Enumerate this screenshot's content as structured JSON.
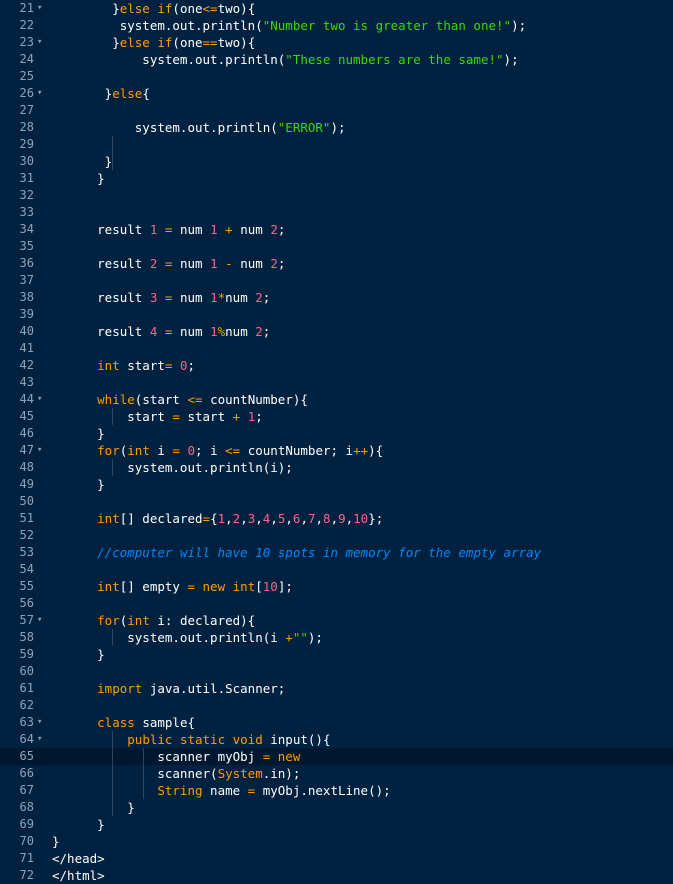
{
  "editor": {
    "colors": {
      "background": "#002240",
      "active_line": "#00182f",
      "keyword": "#ff9d00",
      "string": "#3ad900",
      "number": "#ff628c",
      "comment": "#0088ff",
      "text": "#ffffff",
      "gutter": "#8fa3b8"
    },
    "active_line": 65,
    "lines": [
      {
        "n": "21",
        "fold": true,
        "tokens": [
          [
            "p",
            "        }"
          ],
          [
            "k",
            "else if"
          ],
          [
            "p",
            "(one"
          ],
          [
            "o",
            "<="
          ],
          [
            "p",
            "two){"
          ]
        ]
      },
      {
        "n": "22",
        "fold": false,
        "tokens": [
          [
            "p",
            "         system.out.println("
          ],
          [
            "s",
            "\"Number two is greater than one!\""
          ],
          [
            "p",
            ");"
          ]
        ]
      },
      {
        "n": "23",
        "fold": true,
        "tokens": [
          [
            "p",
            "        }"
          ],
          [
            "k",
            "else if"
          ],
          [
            "p",
            "(one"
          ],
          [
            "o",
            "=="
          ],
          [
            "p",
            "two){"
          ]
        ]
      },
      {
        "n": "24",
        "fold": false,
        "tokens": [
          [
            "p",
            "            system.out.println("
          ],
          [
            "s",
            "\"These numbers are the same!\""
          ],
          [
            "p",
            ");"
          ]
        ]
      },
      {
        "n": "25",
        "fold": false,
        "tokens": []
      },
      {
        "n": "26",
        "fold": true,
        "tokens": [
          [
            "p",
            "       }"
          ],
          [
            "k",
            "else"
          ],
          [
            "p",
            "{"
          ]
        ]
      },
      {
        "n": "27",
        "fold": false,
        "tokens": []
      },
      {
        "n": "28",
        "fold": false,
        "tokens": [
          [
            "p",
            "           system.out.println("
          ],
          [
            "s",
            "\"ERROR\""
          ],
          [
            "p",
            ");"
          ]
        ]
      },
      {
        "n": "29",
        "fold": false,
        "tokens": []
      },
      {
        "n": "30",
        "fold": false,
        "tokens": [
          [
            "p",
            "       }"
          ]
        ]
      },
      {
        "n": "31",
        "fold": false,
        "tokens": [
          [
            "p",
            "      }"
          ]
        ]
      },
      {
        "n": "32",
        "fold": false,
        "tokens": []
      },
      {
        "n": "33",
        "fold": false,
        "tokens": []
      },
      {
        "n": "34",
        "fold": false,
        "tokens": [
          [
            "p",
            "      result "
          ],
          [
            "n",
            "1"
          ],
          [
            "p",
            " "
          ],
          [
            "o",
            "="
          ],
          [
            "p",
            " num "
          ],
          [
            "n",
            "1"
          ],
          [
            "p",
            " "
          ],
          [
            "o",
            "+"
          ],
          [
            "p",
            " num "
          ],
          [
            "n",
            "2"
          ],
          [
            "p",
            ";"
          ]
        ]
      },
      {
        "n": "35",
        "fold": false,
        "tokens": []
      },
      {
        "n": "36",
        "fold": false,
        "tokens": [
          [
            "p",
            "      result "
          ],
          [
            "n",
            "2"
          ],
          [
            "p",
            " "
          ],
          [
            "o",
            "="
          ],
          [
            "p",
            " num "
          ],
          [
            "n",
            "1"
          ],
          [
            "p",
            " "
          ],
          [
            "o",
            "-"
          ],
          [
            "p",
            " num "
          ],
          [
            "n",
            "2"
          ],
          [
            "p",
            ";"
          ]
        ]
      },
      {
        "n": "37",
        "fold": false,
        "tokens": []
      },
      {
        "n": "38",
        "fold": false,
        "tokens": [
          [
            "p",
            "      result "
          ],
          [
            "n",
            "3"
          ],
          [
            "p",
            " "
          ],
          [
            "o",
            "="
          ],
          [
            "p",
            " num "
          ],
          [
            "n",
            "1"
          ],
          [
            "o",
            "*"
          ],
          [
            "p",
            "num "
          ],
          [
            "n",
            "2"
          ],
          [
            "p",
            ";"
          ]
        ]
      },
      {
        "n": "39",
        "fold": false,
        "tokens": []
      },
      {
        "n": "40",
        "fold": false,
        "tokens": [
          [
            "p",
            "      result "
          ],
          [
            "n",
            "4"
          ],
          [
            "p",
            " "
          ],
          [
            "o",
            "="
          ],
          [
            "p",
            " num "
          ],
          [
            "n",
            "1"
          ],
          [
            "o",
            "%"
          ],
          [
            "p",
            "num "
          ],
          [
            "n",
            "2"
          ],
          [
            "p",
            ";"
          ]
        ]
      },
      {
        "n": "41",
        "fold": false,
        "tokens": []
      },
      {
        "n": "42",
        "fold": false,
        "tokens": [
          [
            "p",
            "      "
          ],
          [
            "k",
            "int"
          ],
          [
            "p",
            " start"
          ],
          [
            "o",
            "="
          ],
          [
            "p",
            " "
          ],
          [
            "n",
            "0"
          ],
          [
            "p",
            ";"
          ]
        ]
      },
      {
        "n": "43",
        "fold": false,
        "tokens": []
      },
      {
        "n": "44",
        "fold": true,
        "tokens": [
          [
            "p",
            "      "
          ],
          [
            "k",
            "while"
          ],
          [
            "p",
            "(start "
          ],
          [
            "o",
            "<="
          ],
          [
            "p",
            " countNumber){"
          ]
        ]
      },
      {
        "n": "45",
        "fold": false,
        "tokens": [
          [
            "p",
            "          start "
          ],
          [
            "o",
            "="
          ],
          [
            "p",
            " start "
          ],
          [
            "o",
            "+"
          ],
          [
            "p",
            " "
          ],
          [
            "n",
            "1"
          ],
          [
            "p",
            ";"
          ]
        ]
      },
      {
        "n": "46",
        "fold": false,
        "tokens": [
          [
            "p",
            "      }"
          ]
        ]
      },
      {
        "n": "47",
        "fold": true,
        "tokens": [
          [
            "p",
            "      "
          ],
          [
            "k",
            "for"
          ],
          [
            "p",
            "("
          ],
          [
            "k",
            "int"
          ],
          [
            "p",
            " i "
          ],
          [
            "o",
            "="
          ],
          [
            "p",
            " "
          ],
          [
            "n",
            "0"
          ],
          [
            "p",
            "; i "
          ],
          [
            "o",
            "<="
          ],
          [
            "p",
            " countNumber; i"
          ],
          [
            "o",
            "++"
          ],
          [
            "p",
            "){"
          ]
        ]
      },
      {
        "n": "48",
        "fold": false,
        "tokens": [
          [
            "p",
            "          system.out.println(i);"
          ]
        ]
      },
      {
        "n": "49",
        "fold": false,
        "tokens": [
          [
            "p",
            "      }"
          ]
        ]
      },
      {
        "n": "50",
        "fold": false,
        "tokens": []
      },
      {
        "n": "51",
        "fold": false,
        "tokens": [
          [
            "p",
            "      "
          ],
          [
            "k",
            "int"
          ],
          [
            "p",
            "[] declared"
          ],
          [
            "o",
            "="
          ],
          [
            "p",
            "{"
          ],
          [
            "n",
            "1"
          ],
          [
            "p",
            ","
          ],
          [
            "n",
            "2"
          ],
          [
            "p",
            ","
          ],
          [
            "n",
            "3"
          ],
          [
            "p",
            ","
          ],
          [
            "n",
            "4"
          ],
          [
            "p",
            ","
          ],
          [
            "n",
            "5"
          ],
          [
            "p",
            ","
          ],
          [
            "n",
            "6"
          ],
          [
            "p",
            ","
          ],
          [
            "n",
            "7"
          ],
          [
            "p",
            ","
          ],
          [
            "n",
            "8"
          ],
          [
            "p",
            ","
          ],
          [
            "n",
            "9"
          ],
          [
            "p",
            ","
          ],
          [
            "n",
            "10"
          ],
          [
            "p",
            "};"
          ]
        ]
      },
      {
        "n": "52",
        "fold": false,
        "tokens": []
      },
      {
        "n": "53",
        "fold": false,
        "tokens": [
          [
            "p",
            "      "
          ],
          [
            "c",
            "//computer will have 10 spots in memory for the empty array"
          ]
        ]
      },
      {
        "n": "54",
        "fold": false,
        "tokens": []
      },
      {
        "n": "55",
        "fold": false,
        "tokens": [
          [
            "p",
            "      "
          ],
          [
            "k",
            "int"
          ],
          [
            "p",
            "[] empty "
          ],
          [
            "o",
            "="
          ],
          [
            "p",
            " "
          ],
          [
            "k",
            "new"
          ],
          [
            "p",
            " "
          ],
          [
            "k",
            "int"
          ],
          [
            "p",
            "["
          ],
          [
            "n",
            "10"
          ],
          [
            "p",
            "];"
          ]
        ]
      },
      {
        "n": "56",
        "fold": false,
        "tokens": []
      },
      {
        "n": "57",
        "fold": true,
        "tokens": [
          [
            "p",
            "      "
          ],
          [
            "k",
            "for"
          ],
          [
            "p",
            "("
          ],
          [
            "k",
            "int"
          ],
          [
            "p",
            " i: declared){"
          ]
        ]
      },
      {
        "n": "58",
        "fold": false,
        "tokens": [
          [
            "p",
            "          system.out.println(i "
          ],
          [
            "o",
            "+"
          ],
          [
            "s",
            "\"\""
          ],
          [
            "p",
            ");"
          ]
        ]
      },
      {
        "n": "59",
        "fold": false,
        "tokens": [
          [
            "p",
            "      }"
          ]
        ]
      },
      {
        "n": "60",
        "fold": false,
        "tokens": []
      },
      {
        "n": "61",
        "fold": false,
        "tokens": [
          [
            "p",
            "      "
          ],
          [
            "k",
            "import"
          ],
          [
            "p",
            " java.util.Scanner;"
          ]
        ]
      },
      {
        "n": "62",
        "fold": false,
        "tokens": []
      },
      {
        "n": "63",
        "fold": true,
        "tokens": [
          [
            "p",
            "      "
          ],
          [
            "k",
            "class"
          ],
          [
            "p",
            " sample{"
          ]
        ]
      },
      {
        "n": "64",
        "fold": true,
        "tokens": [
          [
            "p",
            "          "
          ],
          [
            "k",
            "public static void"
          ],
          [
            "p",
            " input(){"
          ]
        ]
      },
      {
        "n": "65",
        "fold": false,
        "tokens": [
          [
            "p",
            "              scanner myObj "
          ],
          [
            "o",
            "="
          ],
          [
            "p",
            " "
          ],
          [
            "k",
            "new"
          ]
        ]
      },
      {
        "n": "66",
        "fold": false,
        "tokens": [
          [
            "p",
            "              scanner("
          ],
          [
            "k",
            "System"
          ],
          [
            "p",
            ".in);"
          ]
        ]
      },
      {
        "n": "67",
        "fold": false,
        "tokens": [
          [
            "p",
            "              "
          ],
          [
            "k",
            "String"
          ],
          [
            "p",
            " name "
          ],
          [
            "o",
            "="
          ],
          [
            "p",
            " myObj.nextLine();"
          ]
        ]
      },
      {
        "n": "68",
        "fold": false,
        "tokens": [
          [
            "p",
            "          }"
          ]
        ]
      },
      {
        "n": "69",
        "fold": false,
        "tokens": [
          [
            "p",
            "      }"
          ]
        ]
      },
      {
        "n": "70",
        "fold": false,
        "tokens": [
          [
            "p",
            "}"
          ]
        ]
      },
      {
        "n": "71",
        "fold": false,
        "tokens": [
          [
            "p",
            "</head>"
          ]
        ]
      },
      {
        "n": "72",
        "fold": false,
        "tokens": [
          [
            "p",
            "</html>"
          ]
        ]
      }
    ]
  }
}
